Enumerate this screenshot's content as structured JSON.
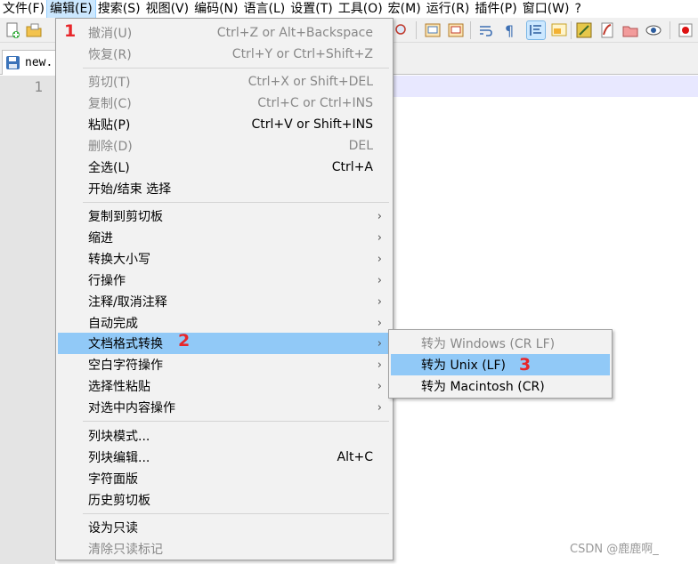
{
  "menubar": {
    "items": [
      "文件(F)",
      "编辑(E)",
      "搜索(S)",
      "视图(V)",
      "编码(N)",
      "语言(L)",
      "设置(T)",
      "工具(O)",
      "宏(M)",
      "运行(R)",
      "插件(P)",
      "窗口(W)",
      "?"
    ]
  },
  "tab": {
    "label": "new."
  },
  "editor": {
    "line_number": "1"
  },
  "edit_menu": {
    "undo": {
      "label": "撤消(U)",
      "shortcut": "Ctrl+Z or Alt+Backspace"
    },
    "redo": {
      "label": "恢复(R)",
      "shortcut": "Ctrl+Y or Ctrl+Shift+Z"
    },
    "cut": {
      "label": "剪切(T)",
      "shortcut": "Ctrl+X or Shift+DEL"
    },
    "copy": {
      "label": "复制(C)",
      "shortcut": "Ctrl+C or Ctrl+INS"
    },
    "paste": {
      "label": "粘贴(P)",
      "shortcut": "Ctrl+V or Shift+INS"
    },
    "delete": {
      "label": "删除(D)",
      "shortcut": "DEL"
    },
    "select_all": {
      "label": "全选(L)",
      "shortcut": "Ctrl+A"
    },
    "begin_end_select": {
      "label": "开始/结束 选择"
    },
    "copy_to_clipboard": {
      "label": "复制到剪切板"
    },
    "indent": {
      "label": "缩进"
    },
    "convert_case": {
      "label": "转换大小写"
    },
    "line_ops": {
      "label": "行操作"
    },
    "comment": {
      "label": "注释/取消注释"
    },
    "auto_complete": {
      "label": "自动完成"
    },
    "eol_conversion": {
      "label": "文档格式转换"
    },
    "blank_ops": {
      "label": "空白字符操作"
    },
    "paste_special": {
      "label": "选择性粘贴"
    },
    "on_selection": {
      "label": "对选中内容操作"
    },
    "column_mode": {
      "label": "列块模式..."
    },
    "column_editor": {
      "label": "列块编辑...",
      "shortcut": "Alt+C"
    },
    "char_panel": {
      "label": "字符面版"
    },
    "clipboard_history": {
      "label": "历史剪切板"
    },
    "set_readonly": {
      "label": "设为只读"
    },
    "clear_readonly": {
      "label": "清除只读标记"
    },
    "arrow": "›"
  },
  "eol_submenu": {
    "windows": "转为 Windows (CR LF)",
    "unix": "转为 Unix (LF)",
    "mac": "转为 Macintosh (CR)"
  },
  "annotations": {
    "step1": "1",
    "step2": "2",
    "step3": "3"
  },
  "watermark": "CSDN @鹿鹿啊_",
  "colors": {
    "highlight": "#91c9f7",
    "badge": "#e8262a",
    "menu_bg": "#f2f2f2"
  }
}
